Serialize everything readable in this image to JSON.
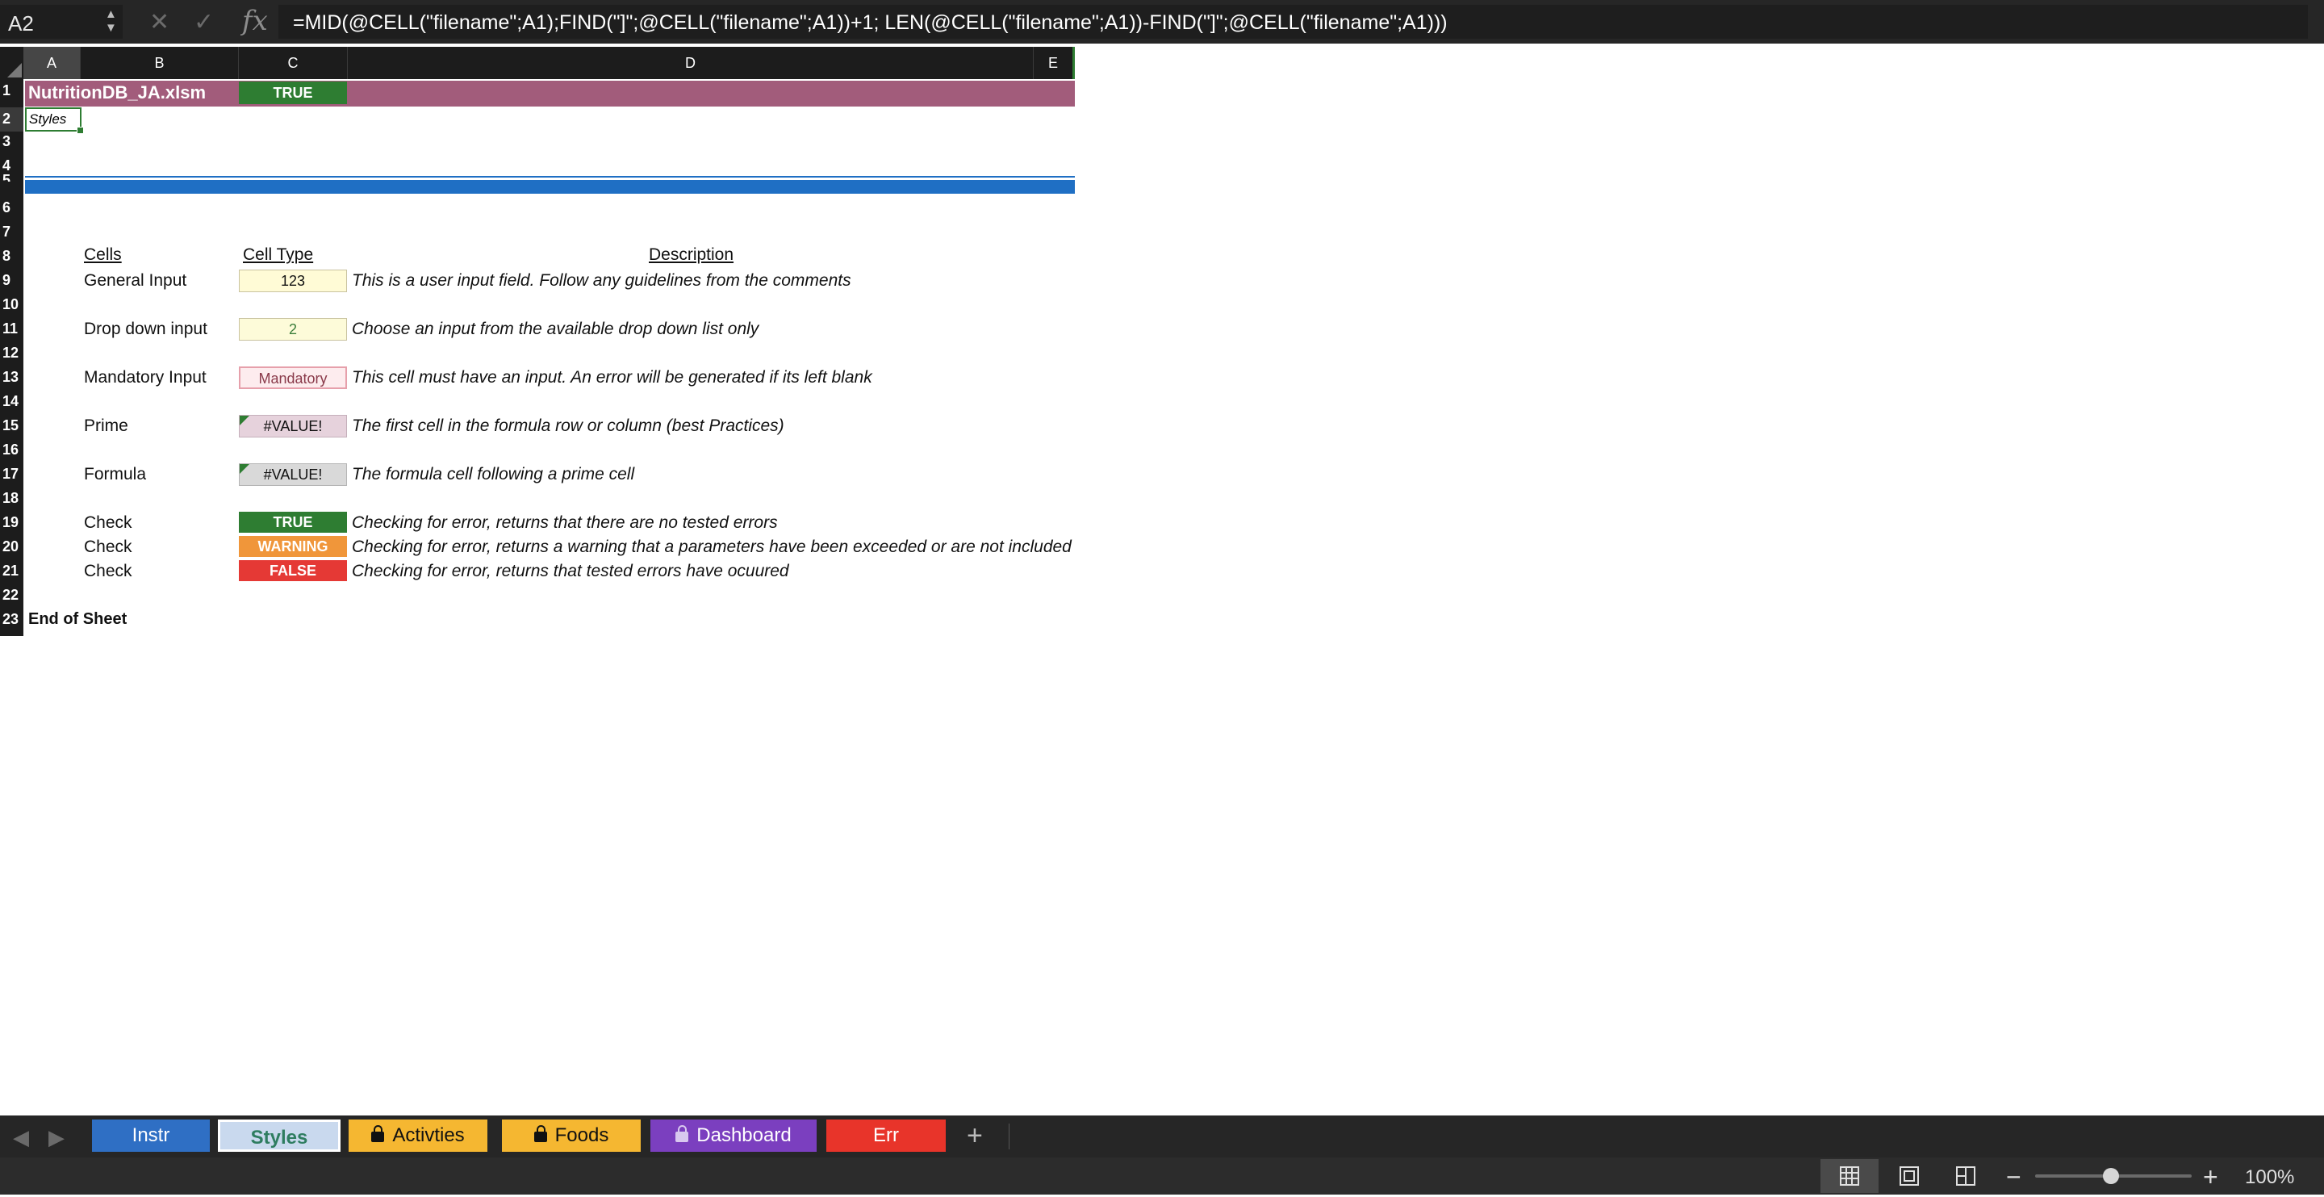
{
  "formula_bar": {
    "name_box": "A2",
    "formula": "=MID(@CELL(\"filename\";A1);FIND(\"]\";@CELL(\"filename\";A1))+1; LEN(@CELL(\"filename\";A1))-FIND(\"]\";@CELL(\"filename\";A1)))"
  },
  "grid": {
    "columns": [
      "A",
      "B",
      "C",
      "D",
      "E"
    ],
    "rows": [
      "1",
      "2",
      "3",
      "4",
      "5",
      "6",
      "7",
      "8",
      "9",
      "10",
      "11",
      "12",
      "13",
      "14",
      "15",
      "16",
      "17",
      "18",
      "19",
      "20",
      "21",
      "22",
      "23"
    ],
    "selected_cell": "A2"
  },
  "sheet": {
    "filename": "NutritionDB_JA.xlsm",
    "header_check": "TRUE",
    "subtitle": "Styles",
    "headers": {
      "cells": "Cells",
      "cell_type": "Cell Type",
      "description": "Description"
    },
    "rows": [
      {
        "label": "General Input",
        "value": "123",
        "style": "general",
        "description": "This is a user input field. Follow any guidelines from the comments"
      },
      {
        "label": "Drop down input",
        "value": "2",
        "style": "dropdown",
        "description": "Choose an input from the available drop down list only"
      },
      {
        "label": "Mandatory Input",
        "value": "Mandatory",
        "style": "mandatory",
        "description": "This cell must have an input. An error will be generated if its left blank"
      },
      {
        "label": "Prime",
        "value": "#VALUE!",
        "style": "prime",
        "description": "The first cell in the formula row or column (best Practices)"
      },
      {
        "label": "Formula",
        "value": "#VALUE!",
        "style": "formula",
        "description": "The formula cell following a prime cell"
      },
      {
        "label": "Check",
        "value": "TRUE",
        "style": "check-true",
        "description": "Checking for error, returns that there are no tested errors"
      },
      {
        "label": "Check",
        "value": "WARNING",
        "style": "check-warning",
        "description": "Checking for error, returns a warning that a parameters have been exceeded or are not included"
      },
      {
        "label": "Check",
        "value": "FALSE",
        "style": "check-false",
        "description": "Checking for error, returns that tested errors have ocuured"
      }
    ],
    "end_label": "End of Sheet"
  },
  "tabs": [
    {
      "label": "Instr",
      "color": "#2f6fc4",
      "locked": false,
      "active": false
    },
    {
      "label": "Styles",
      "color": "#c9d9ee",
      "locked": false,
      "active": true
    },
    {
      "label": "Activties",
      "color": "#f5b731",
      "locked": true,
      "active": false
    },
    {
      "label": "Foods",
      "color": "#f5b731",
      "locked": true,
      "active": false
    },
    {
      "label": "Dashboard",
      "color": "#7b3fbf",
      "locked": true,
      "active": false
    },
    {
      "label": "Err",
      "color": "#e8342a",
      "locked": false,
      "active": false
    }
  ],
  "status_bar": {
    "zoom": "100%"
  },
  "colors": {
    "title_band": "#a25c7b",
    "check_true": "#2e7d32",
    "check_warning": "#f0963a",
    "check_false": "#e53935",
    "divider_blue": "#1f6fc4"
  }
}
